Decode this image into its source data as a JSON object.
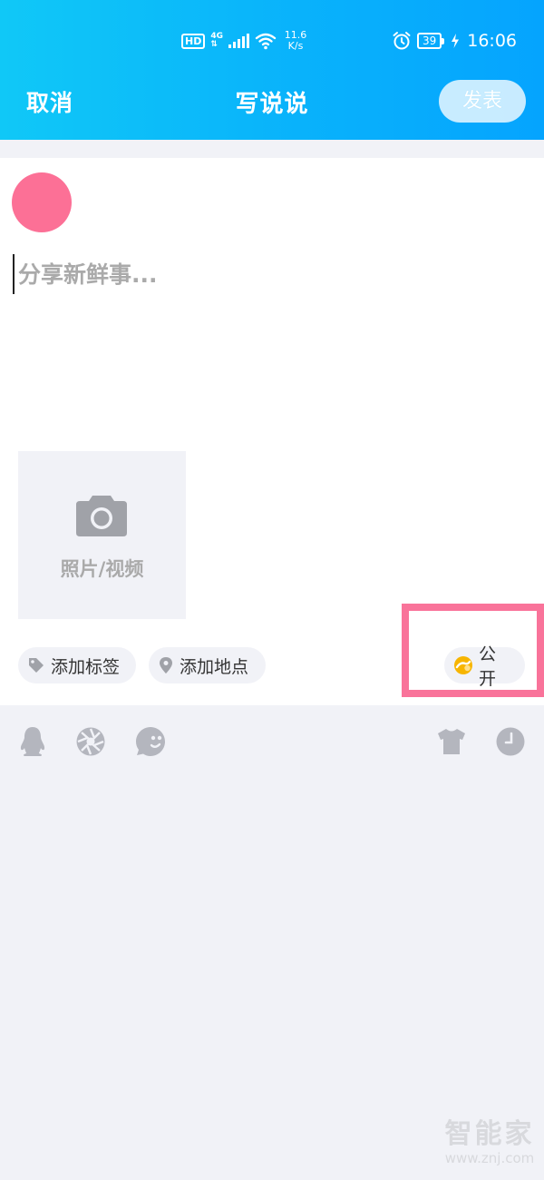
{
  "status_bar": {
    "hd": "HD",
    "network": "4G",
    "net_sub": "⇅",
    "speed_value": "11.6",
    "speed_unit": "K/s",
    "battery": "39",
    "time": "16:06"
  },
  "nav": {
    "cancel_label": "取消",
    "title": "写说说",
    "post_label": "发表"
  },
  "compose": {
    "placeholder": "分享新鲜事...",
    "media_label": "照片/视频",
    "chips": {
      "tag_label": "添加标签",
      "location_label": "添加地点",
      "visibility_label": "公开"
    }
  },
  "toolbar": {
    "icons": [
      "qq-penguin-icon",
      "aperture-icon",
      "sticker-icon",
      "tshirt-icon",
      "clock-icon"
    ]
  },
  "watermark": {
    "brand": "智能家",
    "url": "www.znj.com"
  },
  "colors": {
    "header_start": "#10c8f7",
    "header_end": "#05a4fe",
    "avatar": "#fc7096",
    "highlight": "#f9739a",
    "icon_gray": "#b4b6be",
    "background": "#f1f2f7"
  }
}
